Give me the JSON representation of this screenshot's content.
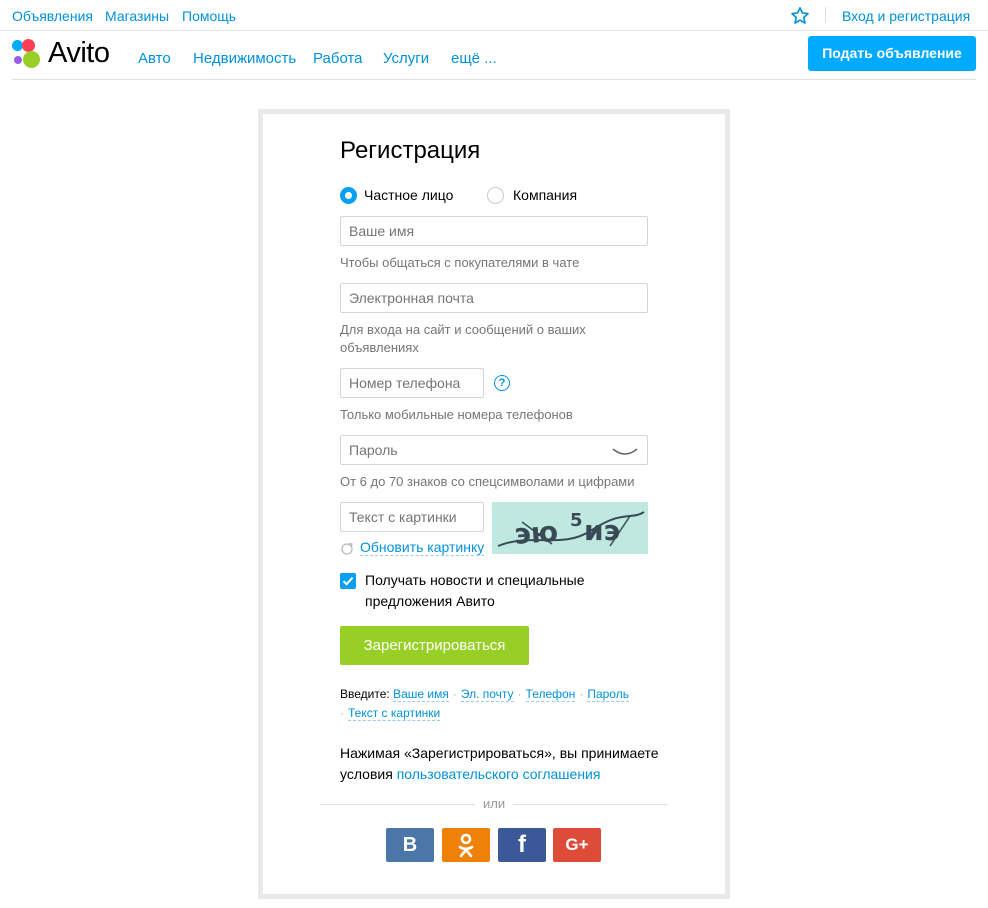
{
  "topbar": {
    "links": [
      "Объявления",
      "Магазины",
      "Помощь"
    ],
    "login": "Вход и регистрация"
  },
  "header": {
    "logo_text": "Avito",
    "nav": [
      "Авто",
      "Недвижимость",
      "Работа",
      "Услуги",
      "ещё ..."
    ],
    "post_button": "Подать объявление"
  },
  "form": {
    "title": "Регистрация",
    "account_types": [
      "Частное лицо",
      "Компания"
    ],
    "selected_type": "Частное лицо",
    "name_placeholder": "Ваше имя",
    "name_hint": "Чтобы общаться с покупателями в чате",
    "email_placeholder": "Электронная почта",
    "email_hint_1": "Для входа на сайт и сообщений о ваших",
    "email_hint_2": "объявлениях",
    "phone_placeholder": "Номер телефона",
    "phone_help": "?",
    "phone_hint": "Только мобильные номера телефонов",
    "password_placeholder": "Пароль",
    "password_hint": "От 6 до 70 знаков со спецсимволами и цифрами",
    "captcha_placeholder": "Текст с картинки",
    "refresh_captcha": "Обновить картинку",
    "captcha_text": "эю5иэ",
    "newsletter_1": "Получать новости и специальные",
    "newsletter_2": "предложения Авито",
    "newsletter_checked": true,
    "register_button": "Зарегистрироваться",
    "fill_prefix": "Введите:",
    "fill_fields": [
      "Ваше имя",
      "Эл. почту",
      "Телефон",
      "Пароль",
      "Текст с картинки"
    ],
    "agree_text_1": "Нажимая «Зарегистрироваться», вы принимаете",
    "agree_text_2": "условия ",
    "agree_link": "пользовательского соглашения",
    "or": "или"
  },
  "social": [
    {
      "name": "vk",
      "glyph": "В",
      "color": "#4a76a8"
    },
    {
      "name": "ok",
      "glyph": "ок",
      "color": "#ee8208"
    },
    {
      "name": "facebook",
      "glyph": "f",
      "color": "#3b5998"
    },
    {
      "name": "google-plus",
      "glyph": "G+",
      "color": "#dd4b39"
    }
  ],
  "colors": {
    "link": "#0091d9",
    "accent": "#00aaff",
    "register": "#97cf26"
  }
}
